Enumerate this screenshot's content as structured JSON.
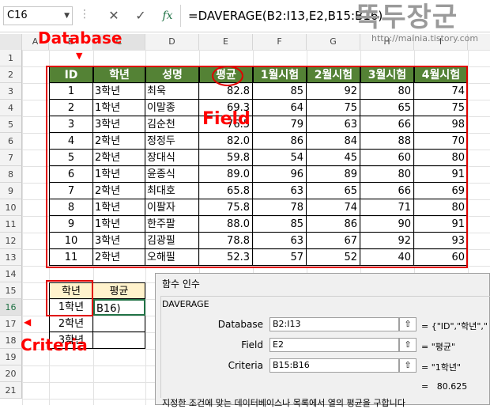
{
  "formula_bar": {
    "name_box": "C16",
    "formula": "=DAVERAGE(B2:I13,E2,B15:B16)",
    "fx_label": "fx"
  },
  "watermark": {
    "text": "똑두장군",
    "url": "http://mainia.tistory.com"
  },
  "columns": [
    "A",
    "B",
    "C",
    "D",
    "E",
    "F",
    "G",
    "H",
    "I"
  ],
  "rows": [
    "1",
    "2",
    "3",
    "4",
    "5",
    "6",
    "7",
    "8",
    "9",
    "10",
    "11",
    "12",
    "13",
    "14",
    "15",
    "16",
    "17",
    "18",
    "19",
    "20",
    "21"
  ],
  "table": {
    "headers": [
      "ID",
      "학년",
      "성명",
      "평균",
      "1월시험",
      "2월시험",
      "3월시험",
      "4월시험"
    ],
    "rows": [
      [
        "1",
        "3학년",
        "최욱",
        "82.8",
        "85",
        "92",
        "80",
        "74"
      ],
      [
        "2",
        "1학년",
        "이말종",
        "69.3",
        "64",
        "75",
        "65",
        "75"
      ],
      [
        "3",
        "3학년",
        "김순천",
        "76.5",
        "79",
        "63",
        "66",
        "98"
      ],
      [
        "4",
        "2학년",
        "정정두",
        "82.0",
        "86",
        "84",
        "88",
        "70"
      ],
      [
        "5",
        "2학년",
        "장대식",
        "59.8",
        "54",
        "45",
        "60",
        "80"
      ],
      [
        "6",
        "1학년",
        "윤종식",
        "89.0",
        "96",
        "89",
        "80",
        "91"
      ],
      [
        "7",
        "2학년",
        "최대호",
        "65.8",
        "63",
        "65",
        "66",
        "69"
      ],
      [
        "8",
        "1학년",
        "이팔자",
        "75.8",
        "78",
        "74",
        "71",
        "80"
      ],
      [
        "9",
        "1학년",
        "한주팔",
        "88.0",
        "85",
        "86",
        "90",
        "91"
      ],
      [
        "10",
        "3학년",
        "김광필",
        "78.8",
        "63",
        "67",
        "92",
        "93"
      ],
      [
        "11",
        "2학년",
        "오해필",
        "52.3",
        "57",
        "52",
        "40",
        "60"
      ]
    ]
  },
  "criteria": {
    "header_grade": "학년",
    "header_avg": "평균",
    "values": [
      "1학년",
      "2학년",
      "3학년"
    ],
    "edit_text": "B16)"
  },
  "annotations": {
    "database": "Database",
    "field": "Field",
    "criteria": "Criteria"
  },
  "dialog": {
    "title": "함수 인수",
    "function_name": "DAVERAGE",
    "args": [
      {
        "label": "Database",
        "value": "B2:I13",
        "result": "{\"ID\",\"학년\",\""
      },
      {
        "label": "Field",
        "value": "E2",
        "result": "\"평균\""
      },
      {
        "label": "Criteria",
        "value": "B15:B16",
        "result": "\"1학년\""
      }
    ],
    "result": "80.625",
    "equals": "=",
    "description": "지정한 조건에 맞는 데이터베이스나 목록에서 열의 평균을 구합니다"
  },
  "colors": {
    "header_bg": "#548235",
    "criteria_bg": "#fff2cc",
    "annotation": "#ff0000"
  }
}
